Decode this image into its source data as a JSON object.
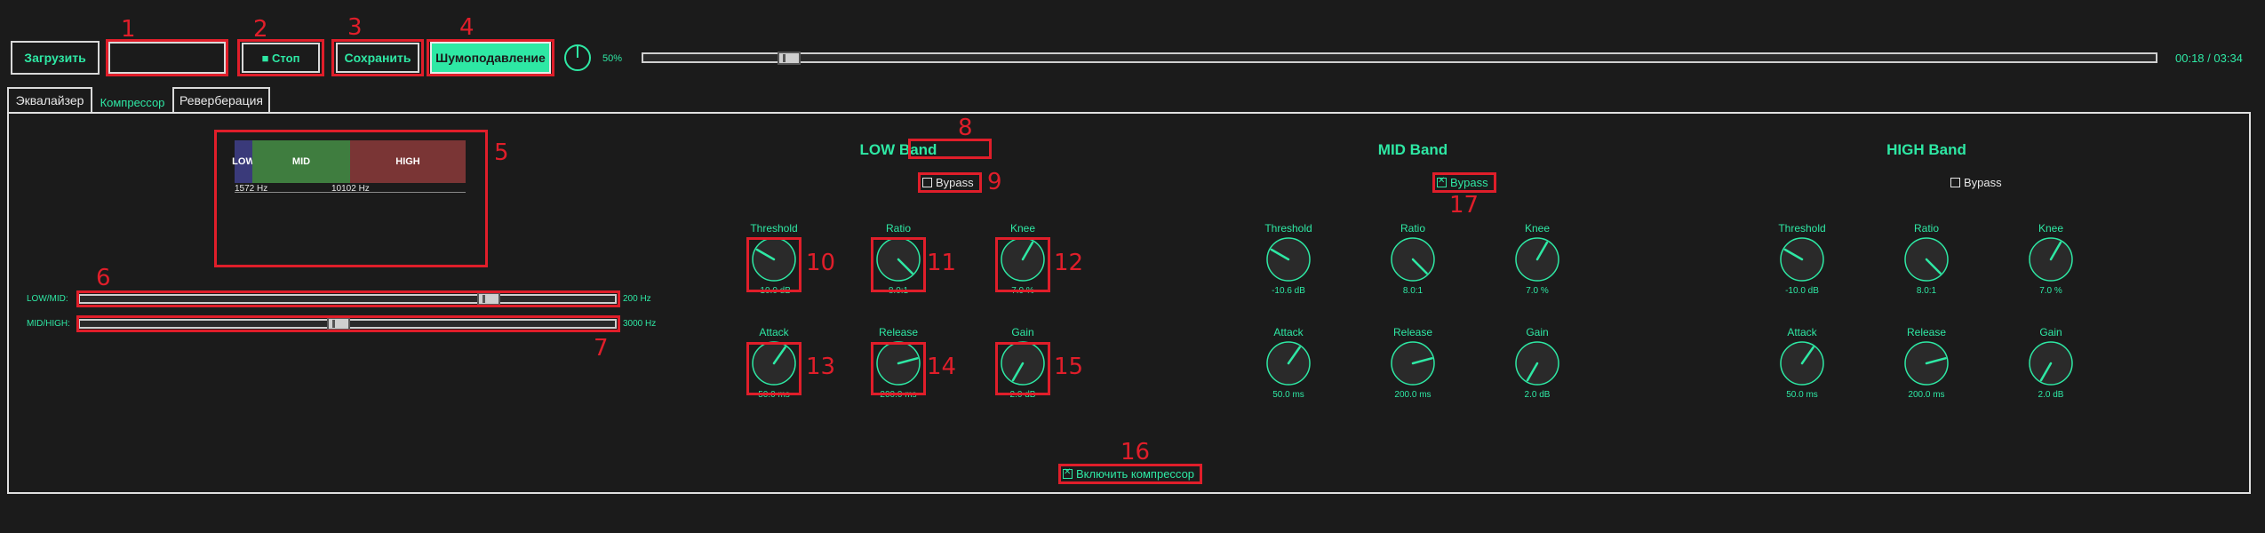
{
  "toolbar": {
    "load_label": "Загрузить",
    "stop_label": "■ Стоп",
    "save_label": "Сохранить",
    "noise_label": "Шумоподавление",
    "volume": "50%",
    "time": "00:18 / 03:34",
    "playback_position": 0.09
  },
  "tabs": [
    "Эквалайзер",
    "Компрессор",
    "Реверберация"
  ],
  "spectrum": {
    "segments": [
      "LOW",
      "MID",
      "HIGH"
    ],
    "freq_low_mid": "1572 Hz",
    "freq_mid_high": "10102 Hz",
    "colors": {
      "low": "#3a3a7a",
      "mid": "#3f7d3f",
      "high": "#7a3535"
    }
  },
  "crossovers": {
    "low_mid": {
      "label": "LOW/MID:",
      "value": "200 Hz",
      "position": 0.77
    },
    "mid_high": {
      "label": "MID/HIGH:",
      "value": "3000 Hz",
      "position": 0.48
    }
  },
  "bands": [
    {
      "title": "LOW Band",
      "bypass_label": "Bypass",
      "bypass": false,
      "knobs": [
        {
          "label": "Threshold",
          "value": "-10.0 dB",
          "angle": -60
        },
        {
          "label": "Ratio",
          "value": "8.0:1",
          "angle": 135
        },
        {
          "label": "Knee",
          "value": "7.0 %",
          "angle": 30
        },
        {
          "label": "Attack",
          "value": "50.0 ms",
          "angle": 35
        },
        {
          "label": "Release",
          "value": "200.0 ms",
          "angle": 75
        },
        {
          "label": "Gain",
          "value": "2.0 dB",
          "angle": -150
        }
      ]
    },
    {
      "title": "MID Band",
      "bypass_label": "Bypass",
      "bypass": true,
      "knobs": [
        {
          "label": "Threshold",
          "value": "-10.6 dB",
          "angle": -60
        },
        {
          "label": "Ratio",
          "value": "8.0:1",
          "angle": 135
        },
        {
          "label": "Knee",
          "value": "7.0 %",
          "angle": 30
        },
        {
          "label": "Attack",
          "value": "50.0 ms",
          "angle": 35
        },
        {
          "label": "Release",
          "value": "200.0 ms",
          "angle": 75
        },
        {
          "label": "Gain",
          "value": "2.0 dB",
          "angle": -150
        }
      ]
    },
    {
      "title": "HIGH Band",
      "bypass_label": "Bypass",
      "bypass": false,
      "knobs": [
        {
          "label": "Threshold",
          "value": "-10.0 dB",
          "angle": -60
        },
        {
          "label": "Ratio",
          "value": "8.0:1",
          "angle": 135
        },
        {
          "label": "Knee",
          "value": "7.0 %",
          "angle": 30
        },
        {
          "label": "Attack",
          "value": "50.0 ms",
          "angle": 35
        },
        {
          "label": "Release",
          "value": "200.0 ms",
          "angle": 75
        },
        {
          "label": "Gain",
          "value": "2.0 dB",
          "angle": -150
        }
      ]
    }
  ],
  "enable_compressor": {
    "label": "Включить компрессор",
    "checked": true
  },
  "annotations": [
    "1",
    "2",
    "3",
    "4",
    "5",
    "6",
    "7",
    "8",
    "9",
    "10",
    "11",
    "12",
    "13",
    "14",
    "15",
    "16",
    "17"
  ],
  "colors": {
    "accent": "#2ee8a4",
    "annotation": "#e01e2a",
    "background": "#1b1b1b"
  }
}
